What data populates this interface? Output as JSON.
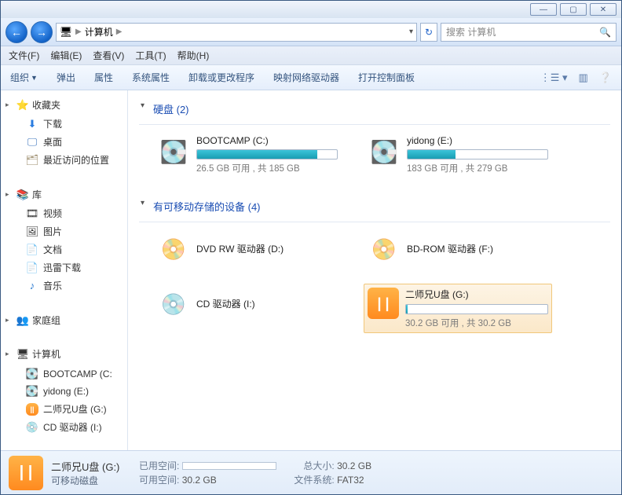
{
  "breadcrumb": {
    "icon": "computer-icon",
    "text": "计算机",
    "separator": "▶"
  },
  "search": {
    "placeholder": "搜索 计算机"
  },
  "menu": [
    "文件(F)",
    "编辑(E)",
    "查看(V)",
    "工具(T)",
    "帮助(H)"
  ],
  "toolbar": {
    "organize": "组织",
    "items": [
      "弹出",
      "属性",
      "系统属性",
      "卸载或更改程序",
      "映射网络驱动器",
      "打开控制面板"
    ]
  },
  "sidebar": {
    "favorites": {
      "label": "收藏夹",
      "items": [
        "下载",
        "桌面",
        "最近访问的位置"
      ]
    },
    "library": {
      "label": "库",
      "items": [
        "视频",
        "图片",
        "文档",
        "迅雷下载",
        "音乐"
      ]
    },
    "homegroup": {
      "label": "家庭组"
    },
    "computer": {
      "label": "计算机",
      "items": [
        "BOOTCAMP (C:",
        "yidong (E:)",
        "二师兄U盘 (G:)",
        "CD 驱动器 (I:)"
      ]
    }
  },
  "sections": {
    "hdd": {
      "label": "硬盘 (2)"
    },
    "removable": {
      "label": "有可移动存储的设备 (4)"
    }
  },
  "drives": {
    "c": {
      "name": "BOOTCAMP (C:)",
      "free": "26.5 GB 可用 , 共 185 GB",
      "fillPct": 86
    },
    "e": {
      "name": "yidong (E:)",
      "free": "183 GB 可用 , 共 279 GB",
      "fillPct": 34
    },
    "d": {
      "name": "DVD RW 驱动器 (D:)"
    },
    "f": {
      "name": "BD-ROM 驱动器 (F:)"
    },
    "i": {
      "name": "CD 驱动器 (I:)"
    },
    "g": {
      "name": "二师兄U盘 (G:)",
      "free": "30.2 GB 可用 , 共 30.2 GB",
      "fillPct": 1
    }
  },
  "status": {
    "title": "二师兄U盘 (G:)",
    "subtitle": "可移动磁盘",
    "usedLabel": "已用空间:",
    "freeLabel": "可用空间:",
    "freeValue": "30.2 GB",
    "totalLabel": "总大小:",
    "totalValue": "30.2 GB",
    "fsLabel": "文件系统:",
    "fsValue": "FAT32"
  }
}
